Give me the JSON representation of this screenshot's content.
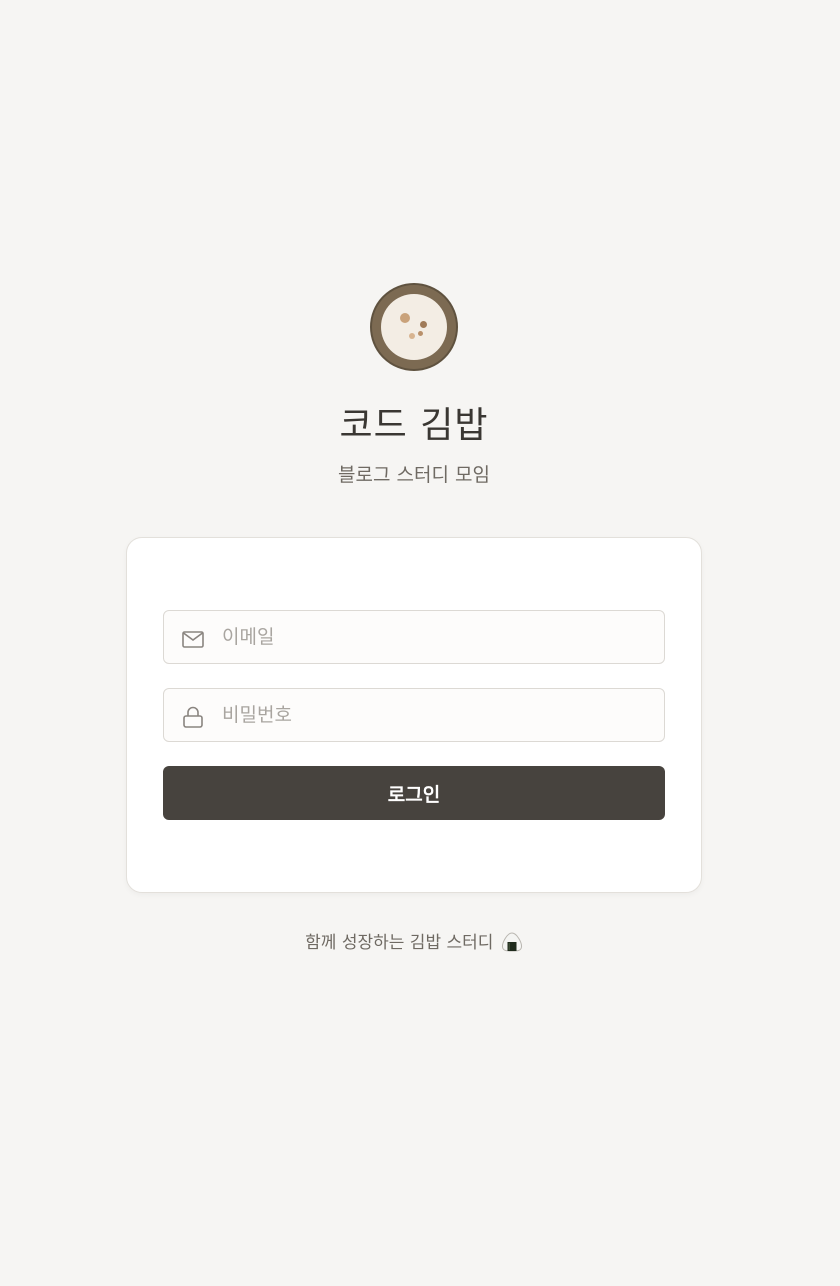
{
  "brand": {
    "title": "코드 김밥",
    "subtitle": "블로그 스터디 모임",
    "logo_icon": "gimbap-slice-icon"
  },
  "login_form": {
    "email": {
      "placeholder": "이메일",
      "value": "",
      "icon": "mail-icon"
    },
    "password": {
      "placeholder": "비밀번호",
      "value": "",
      "icon": "lock-icon"
    },
    "submit_label": "로그인"
  },
  "footer": {
    "text": "함께 성장하는 김밥 스터디",
    "emoji_icon": "onigiri-icon"
  },
  "colors": {
    "background": "#f6f5f3",
    "button": "#47433e",
    "logo_rim": "#7c6a52"
  }
}
